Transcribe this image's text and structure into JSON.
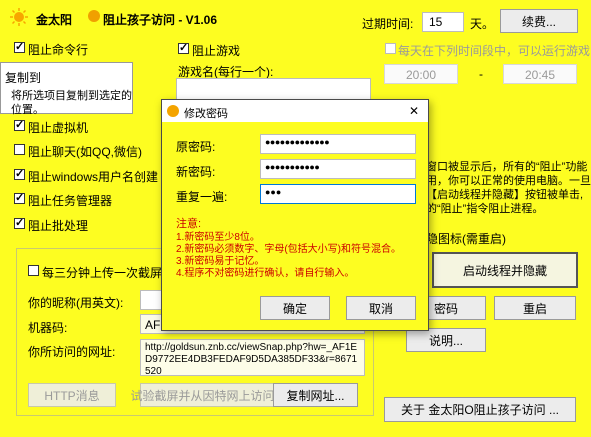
{
  "window": {
    "title": "金太阳",
    "title_mid": "阻止孩子访问 - V1.06",
    "expire_label": "过期时间:",
    "expire_value": "15",
    "expire_unit": "天。",
    "renew_button": "续费..."
  },
  "left": {
    "block_cmd": "阻止命令行",
    "block_vm": "阻止虚拟机",
    "block_chat": "阻止聊天(如QQ,微信)",
    "block_winuser": "阻止windows用户名创建",
    "block_taskmgr": "阻止任务管理器",
    "block_batch": "阻止批处理"
  },
  "tooltip": {
    "title": "复制到",
    "text": "将所选项目复制到选定的位置。"
  },
  "game": {
    "block_games": "阻止游戏",
    "name_label": "游戏名(每行一个):",
    "allow_label": "每天在下列时间段中，可以运行游戏:",
    "time_from": "20:00",
    "time_sep": "-",
    "time_to": "20:45"
  },
  "right_text": {
    "line1": "窗口被显示后，所有的“阻止”功能",
    "line2": "用，你可以正常的使用电脑。一旦",
    "line3": "【启动线程并隐藏】按钮被单击,",
    "line4": "的“阻止”指令阻止进程。",
    "hide_icon": "隐图标(需重启)"
  },
  "upload": {
    "every3min": "每三分钟上传一次截屏。",
    "nickname_label": "你的昵称(用英文):",
    "machine_label": "机器码:",
    "machine_value": "AF1",
    "url_label": "你所访问的网址:",
    "url_value": "http://goldsun.znb.cc/viewSnap.php?hw=_AF1ED9772EE4DB3FEDAF9D5DA385DF33&r=8671520",
    "http_button": "HTTP消息",
    "test_button": "试验截屏并从因特网上访问...",
    "copy_button": "复制网址..."
  },
  "buttons": {
    "start_hide": "启动线程并隐藏",
    "change_pwd_partial": "密码",
    "restart": "重启",
    "help": "说明...",
    "about": "关于 金太阳O阻止孩子访问 ..."
  },
  "dialog": {
    "title": "修改密码",
    "close": "✕",
    "old_label": "原密码:",
    "old_value": "●●●●●●●●●●●●●",
    "new_label": "新密码:",
    "new_value": "●●●●●●●●●●●",
    "repeat_label": "重复一遍:",
    "repeat_value": "●●●",
    "note_title": "注意:",
    "note1": "1.新密码至少8位。",
    "note2": "2.新密码必须数字、字母(包括大小写)和符号混合。",
    "note3": "3.新密码易于记忆。",
    "note4": "4.程序不对密码进行确认，请自行输入。",
    "ok": "确定",
    "cancel": "取消"
  },
  "colors": {
    "background": "#fdfd21",
    "dialog_titlebar": "#ffffff",
    "focus_border": "#0078d7",
    "note_text": "#cc0000"
  }
}
